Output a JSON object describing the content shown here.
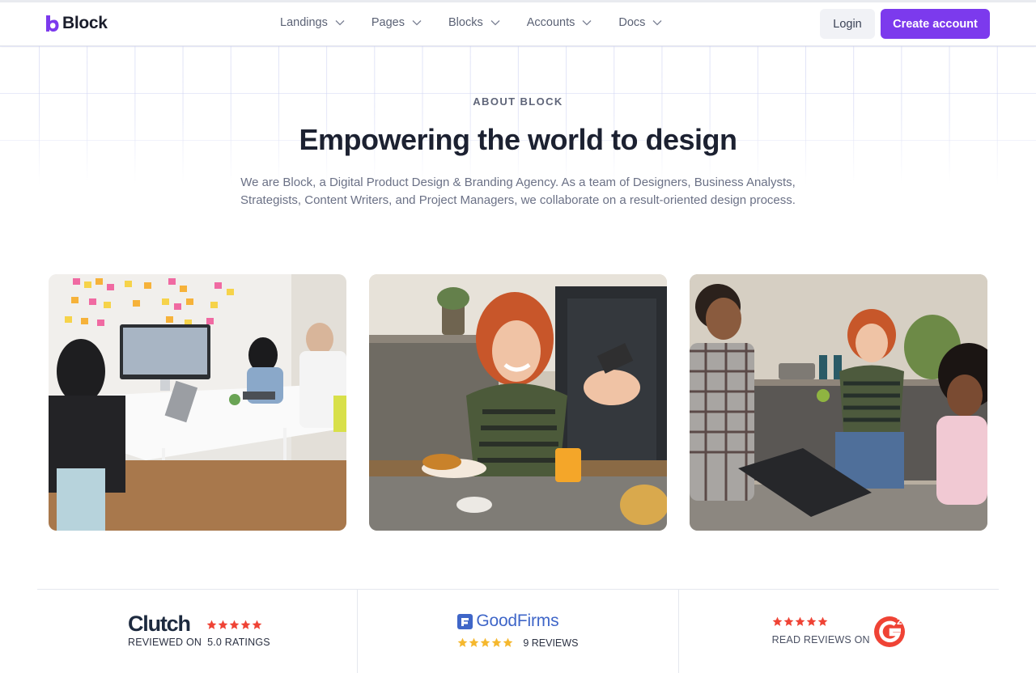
{
  "brand": {
    "name": "Block",
    "accent": "#7c3aed"
  },
  "nav": {
    "items": [
      {
        "label": "Landings"
      },
      {
        "label": "Pages"
      },
      {
        "label": "Blocks"
      },
      {
        "label": "Accounts"
      },
      {
        "label": "Docs"
      }
    ],
    "login_label": "Login",
    "create_label": "Create account"
  },
  "hero": {
    "eyebrow": "ABOUT BLOCK",
    "title": "Empowering the world to design",
    "subtitle": "We are Block, a Digital Product Design & Branding Agency. As a team of Designers, Business Analysts, Strategists, Content Writers, and Project Managers, we collaborate on a result-oriented design process."
  },
  "photos": [
    {
      "icon": "office-team-photo"
    },
    {
      "icon": "woman-with-phone-photo"
    },
    {
      "icon": "kitchen-conversation-photo"
    }
  ],
  "reviews": {
    "clutch": {
      "logo": "Clutch",
      "label": "REVIEWED ON",
      "rating": "5.0 RATINGS",
      "stars": 5,
      "star_color": "#ef4335"
    },
    "goodfirms": {
      "logo": "GoodFirms",
      "count": "9 REVIEWS",
      "stars": 5,
      "star_color": "#f5b82e"
    },
    "g2": {
      "label": "READ REVIEWS ON",
      "logo": "G2",
      "stars": 5,
      "star_color": "#ef4335"
    }
  }
}
